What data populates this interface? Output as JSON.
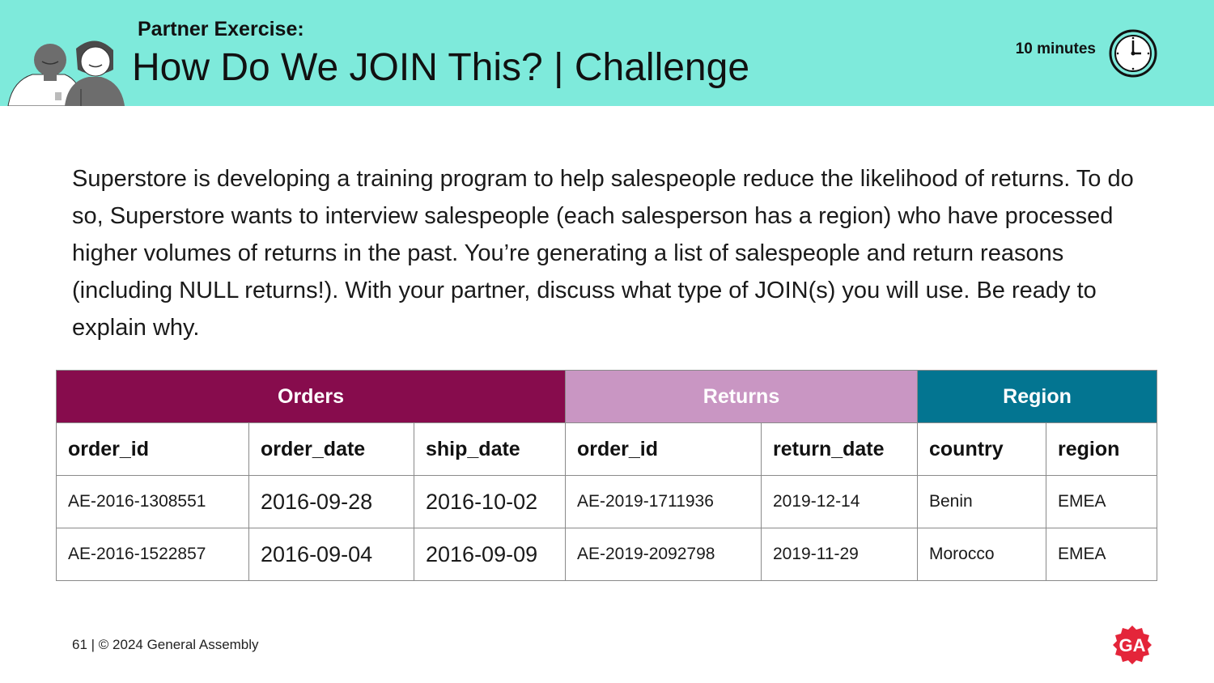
{
  "header": {
    "kicker": "Partner Exercise:",
    "title": "How Do We JOIN This? | Challenge",
    "timer": "10 minutes",
    "bg_color": "#7eeadb"
  },
  "body_text": "Superstore is developing a training program to help salespeople reduce the likelihood of returns. To do so, Superstore wants to interview salespeople (each salesperson has a region) who have processed higher volumes of returns in the past. You’re generating a list of salespeople and return reasons (including NULL returns!). With your partner, discuss what type of JOIN(s) you will use. Be ready to explain why.",
  "tables": {
    "orders": {
      "title": "Orders",
      "color": "#870c4d",
      "columns": [
        "order_id",
        "order_date",
        "ship_date"
      ],
      "rows": [
        [
          "AE-2016-1308551",
          "2016-09-28",
          "2016-10-02"
        ],
        [
          "AE-2016-1522857",
          "2016-09-04",
          "2016-09-09"
        ]
      ]
    },
    "returns": {
      "title": "Returns",
      "color": "#c996c3",
      "columns": [
        "order_id",
        "return_date"
      ],
      "rows": [
        [
          "AE-2019-1711936",
          "2019-12-14"
        ],
        [
          "AE-2019-2092798",
          "2019-11-29"
        ]
      ]
    },
    "region": {
      "title": "Region",
      "color": "#037591",
      "columns": [
        "country",
        "region"
      ],
      "rows": [
        [
          "Benin",
          "EMEA"
        ],
        [
          "Morocco",
          "EMEA"
        ]
      ]
    }
  },
  "footer": {
    "page": "61",
    "copyright": "© 2024 General Assembly"
  },
  "logo": {
    "text": "GA",
    "color": "#e4253a"
  },
  "icons": [
    "people-illustration",
    "clock-icon",
    "ga-logo"
  ]
}
